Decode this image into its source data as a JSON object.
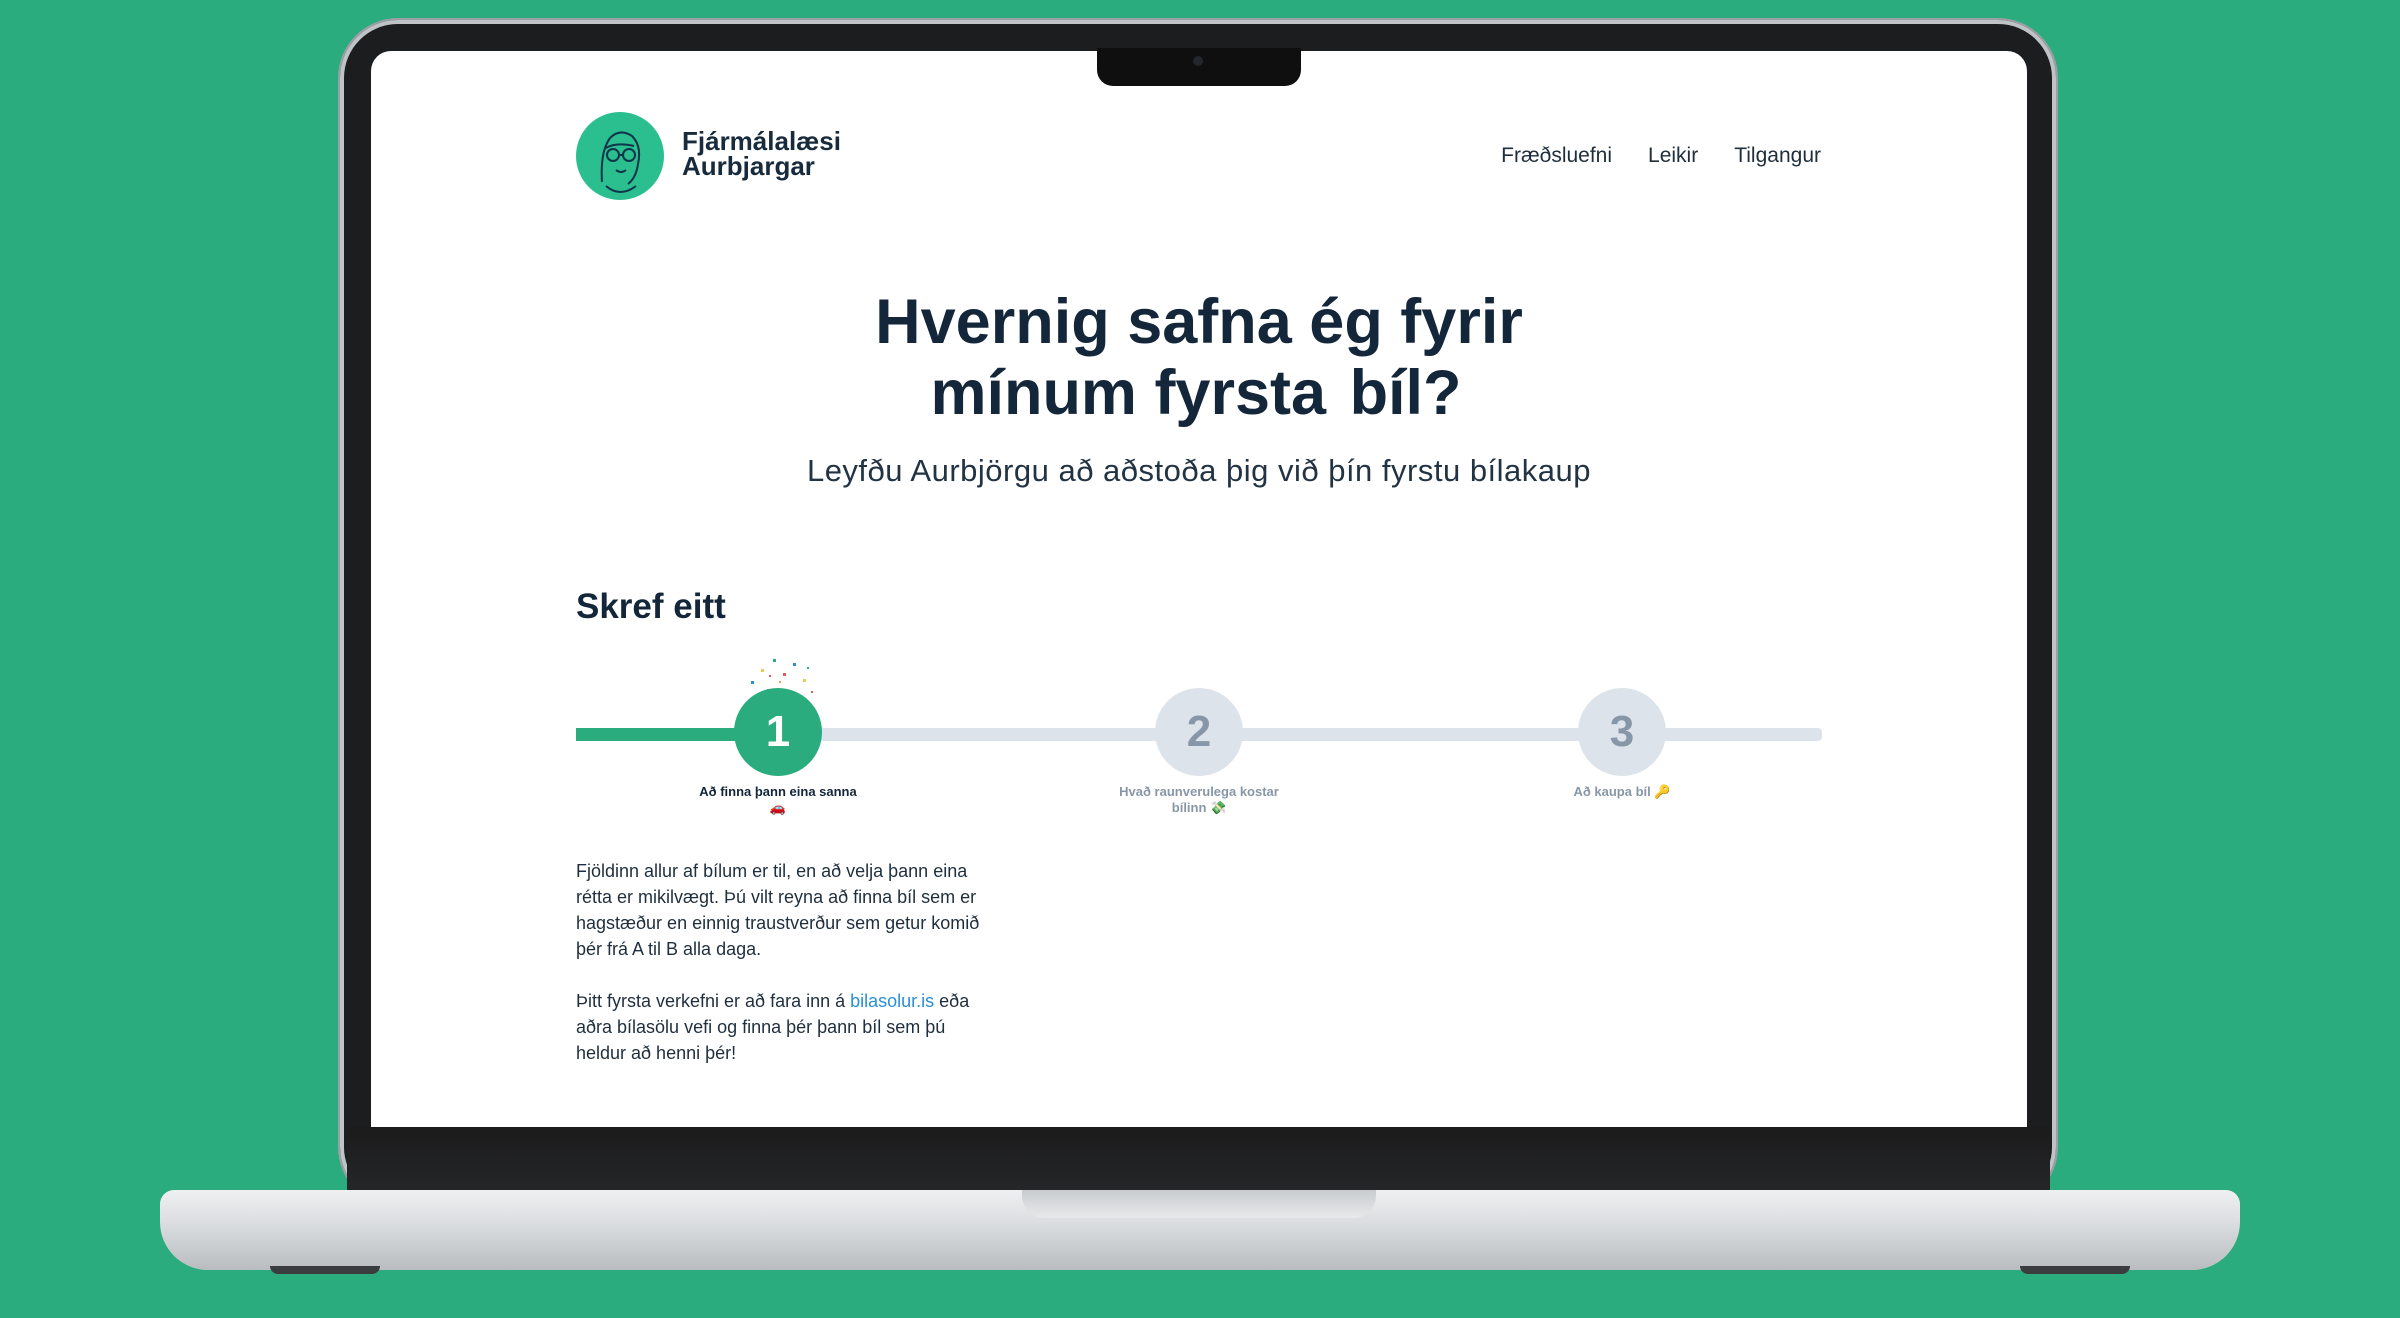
{
  "brand": {
    "line1": "Fjármálalæsi",
    "line2": "Aurbjargar"
  },
  "nav": {
    "item1": "Fræðsluefni",
    "item2": "Leikir",
    "item3": "Tilgangur"
  },
  "hero": {
    "title_line1": "Hvernig safna ég fyrir",
    "title_line2": "mínum fyrsta",
    "title_highlight": "bíl?",
    "subtitle": "Leyfðu Aurbjörgu að aðstoða þig við þín fyrstu bílakaup"
  },
  "section": {
    "title": "Skref eitt"
  },
  "steps": [
    {
      "number": "1",
      "label": "Að finna þann eina sanna 🚗"
    },
    {
      "number": "2",
      "label": "Hvað raunverulega kostar bílinn 💸"
    },
    {
      "number": "3",
      "label": "Að kaupa bíl 🔑"
    }
  ],
  "progress": {
    "fraction": 0.16
  },
  "body": {
    "p1": "Fjöldinn allur af bílum er til, en að velja þann eina rétta er mikilvægt. Þú vilt reyna að finna bíl sem er hagstæður en einnig traustverður sem getur komið þér frá A til B alla daga.",
    "p2_before": "Þitt fyrsta verkefni er að fara inn á ",
    "p2_link": "bilasolur.is",
    "p2_after": " eða aðra bílasölu vefi og finna þér þann bíl sem þú heldur að henni þér!"
  },
  "colors": {
    "accent": "#2aac7e",
    "highlight": "#2bbf8f",
    "text": "#13263a",
    "link": "#2b8fd6",
    "inactive": "#dde3ea"
  }
}
